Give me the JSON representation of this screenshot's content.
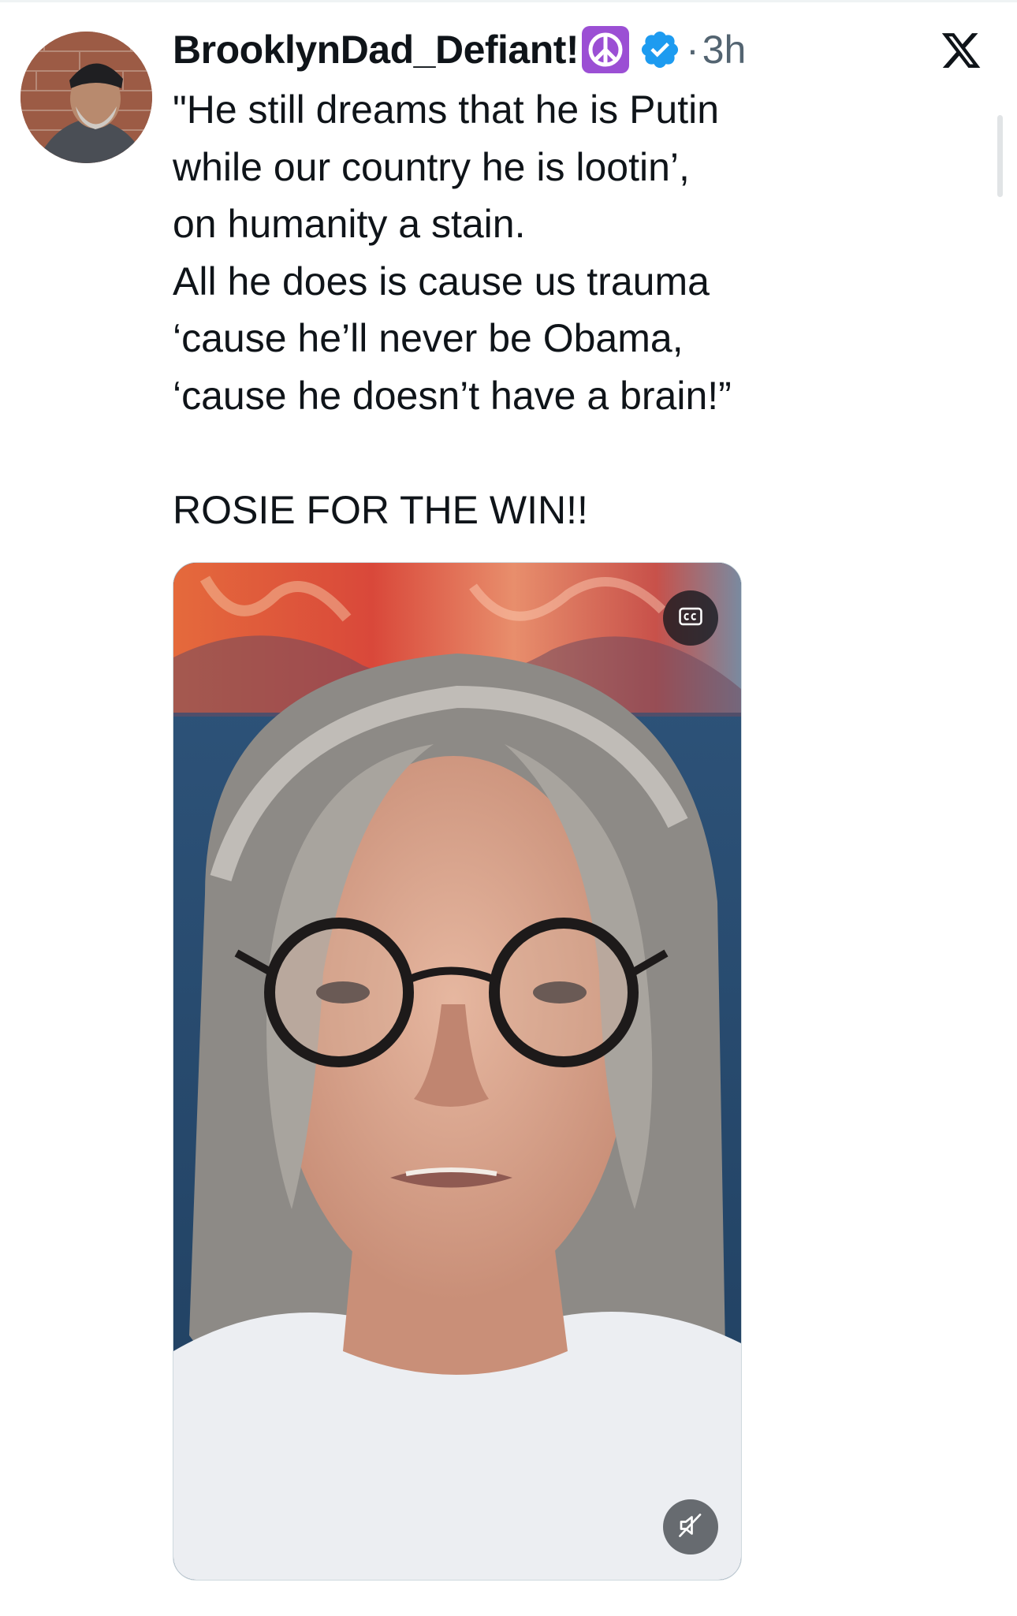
{
  "tweet": {
    "author": {
      "display_name": "BrooklynDad_Defiant!",
      "name_emoji": "peace-symbol-icon",
      "verified": true
    },
    "separator": "·",
    "timestamp": "3h",
    "text_lines": [
      "\"He still dreams that he is Putin",
      "while our country he is lootin’,",
      "on humanity a stain.",
      "All he does is cause us trauma",
      "‘cause he’ll never be Obama,",
      "‘cause he doesn’t have a brain!”",
      "",
      "ROSIE FOR THE WIN!!"
    ],
    "media": {
      "type": "video",
      "captions_button_icon": "cc-icon",
      "mute_button_icon": "speaker-muted-icon"
    }
  },
  "brand_icon": "x-logo-icon",
  "colors": {
    "text_primary": "#0f1419",
    "text_secondary": "#536471",
    "verified_blue": "#1d9bf0",
    "emoji_purple": "#9b4fd4"
  }
}
